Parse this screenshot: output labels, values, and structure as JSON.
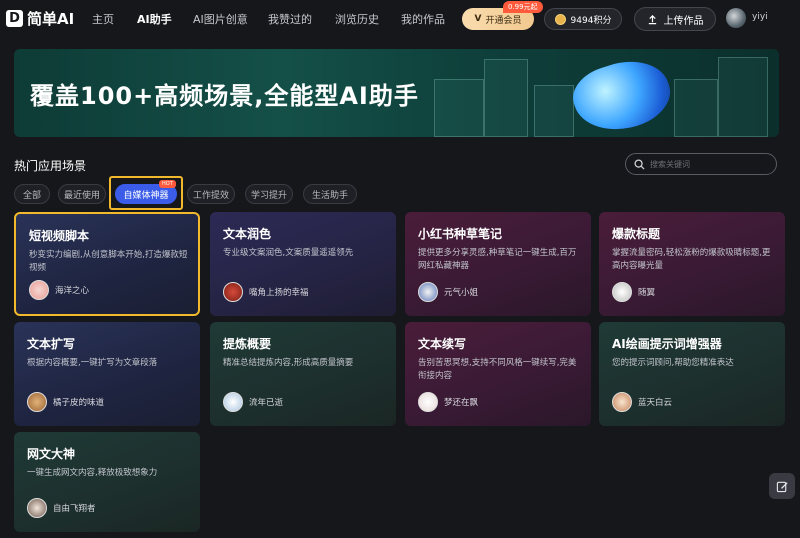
{
  "app": {
    "logo_mark": "D",
    "logo_text": "简单AI"
  },
  "nav": {
    "items": [
      {
        "label": "主页",
        "active": false
      },
      {
        "label": "AI助手",
        "active": true
      },
      {
        "label": "AI图片创意",
        "active": false
      },
      {
        "label": "我赞过的",
        "active": false
      },
      {
        "label": "浏览历史",
        "active": false
      },
      {
        "label": "我的作品",
        "active": false
      }
    ],
    "vip_label": "开通会员",
    "vip_badge": "0.99元起",
    "points_label": "9494积分",
    "upload_label": "上传作品",
    "username": "yiyi"
  },
  "banner": {
    "title": "覆盖100+高频场景,全能型AI助手"
  },
  "section": {
    "title": "热门应用场景",
    "search_placeholder": "搜索关键词"
  },
  "filters": [
    {
      "label": "全部",
      "active": false
    },
    {
      "label": "最近使用",
      "active": false
    },
    {
      "label": "自媒体神器",
      "active": true,
      "badge": "HOT"
    },
    {
      "label": "工作提效",
      "active": false
    },
    {
      "label": "学习提升",
      "active": false
    },
    {
      "label": "生活助手",
      "active": false
    }
  ],
  "cards": [
    {
      "title": "短视频脚本",
      "desc": "秒变实力编剧,从创意脚本开始,打造爆款短视频",
      "author": "海洋之心"
    },
    {
      "title": "文本润色",
      "desc": "专业级文案润色,文案质量遥遥领先",
      "author": "嘴角上扬的幸福"
    },
    {
      "title": "小红书种草笔记",
      "desc": "提供更多分享灵感,种草笔记一键生成,百万网红私藏神器",
      "author": "元气小姐"
    },
    {
      "title": "爆款标题",
      "desc": "掌握流量密码,轻松涨粉的爆款吸睛标题,更高内容曝光量",
      "author": "随翼"
    },
    {
      "title": "文本扩写",
      "desc": "根据内容概要,一键扩写为文章段落",
      "author": "橘子皮的味道"
    },
    {
      "title": "提炼概要",
      "desc": "精准总结提炼内容,形成高质量摘要",
      "author": "流年已逝"
    },
    {
      "title": "文本续写",
      "desc": "告别苦思冥想,支持不同风格一键续写,完美衔接内容",
      "author": "梦还在飘"
    },
    {
      "title": "AI绘画提示词增强器",
      "desc": "您的提示词顾问,帮助您精准表达",
      "author": "蓝天白云"
    },
    {
      "title": "网文大神",
      "desc": "一键生成网文内容,释放极致想象力",
      "author": "自由飞翔者"
    }
  ],
  "colors": {
    "accent": "#3a5ce8",
    "highlight": "#f2b92c",
    "background": "#16171b"
  }
}
